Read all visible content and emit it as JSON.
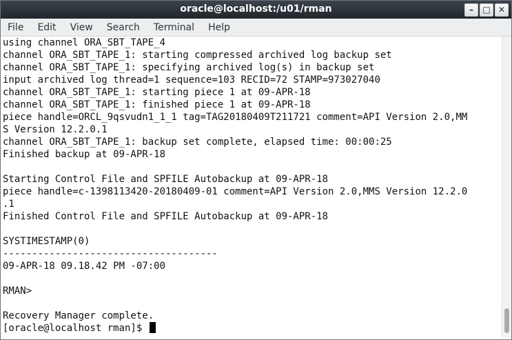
{
  "window": {
    "title": "oracle@localhost:/u01/rman",
    "controls": {
      "minimize": "–",
      "maximize": "□",
      "close": "✕"
    }
  },
  "menu": [
    "File",
    "Edit",
    "View",
    "Search",
    "Terminal",
    "Help"
  ],
  "terminal": {
    "lines": [
      "using channel ORA_SBT_TAPE_4",
      "channel ORA_SBT_TAPE_1: starting compressed archived log backup set",
      "channel ORA_SBT_TAPE_1: specifying archived log(s) in backup set",
      "input archived log thread=1 sequence=103 RECID=72 STAMP=973027040",
      "channel ORA_SBT_TAPE_1: starting piece 1 at 09-APR-18",
      "channel ORA_SBT_TAPE_1: finished piece 1 at 09-APR-18",
      "piece handle=ORCL_9qsvudn1_1_1 tag=TAG20180409T211721 comment=API Version 2.0,MM",
      "S Version 12.2.0.1",
      "channel ORA_SBT_TAPE_1: backup set complete, elapsed time: 00:00:25",
      "Finished backup at 09-APR-18",
      "",
      "Starting Control File and SPFILE Autobackup at 09-APR-18",
      "piece handle=c-1398113420-20180409-01 comment=API Version 2.0,MMS Version 12.2.0",
      ".1",
      "Finished Control File and SPFILE Autobackup at 09-APR-18",
      "",
      "SYSTIMESTAMP(0)",
      "-------------------------------------",
      "09-APR-18 09.18.42 PM -07:00",
      "",
      "RMAN>",
      "",
      "Recovery Manager complete."
    ],
    "prompt": "[oracle@localhost rman]$ "
  }
}
